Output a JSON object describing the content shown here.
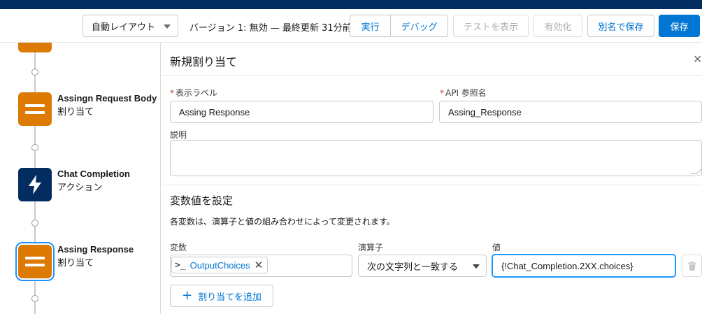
{
  "toolbar": {
    "layout_select": "自動レイアウト",
    "version_text": "バージョン 1: 無効 — 最終更新 31分前",
    "run_label": "実行",
    "debug_label": "デバッグ",
    "show_test_label": "テストを表示",
    "activate_label": "有効化",
    "save_as_label": "別名で保存",
    "save_label": "保存"
  },
  "canvas": {
    "nodes": [
      {
        "title": "Assingn Request Body",
        "subtitle": "割り当て",
        "type": "assignment"
      },
      {
        "title": "Chat Completion",
        "subtitle": "アクション",
        "type": "action"
      },
      {
        "title": "Assing Response",
        "subtitle": "割り当て",
        "type": "assignment",
        "selected": true
      }
    ]
  },
  "panel": {
    "title": "新規割り当て",
    "label_field": {
      "label": "表示ラベル",
      "value": "Assing Response",
      "required": true
    },
    "api_field": {
      "label": "API 参照名",
      "value": "Assing_Response",
      "required": true
    },
    "description_field": {
      "label": "説明",
      "value": ""
    },
    "section_title": "変数値を設定",
    "section_desc": "各変数は、演算子と値の組み合わせによって変更されます。",
    "columns": {
      "variable": "変数",
      "operator": "演算子",
      "value": "値"
    },
    "row": {
      "variable": "OutputChoices",
      "operator": "次の文字列と一致する",
      "value": "{!Chat_Completion.2XX.choices}"
    },
    "add_label": "割り当てを追加"
  },
  "colors": {
    "brand_blue": "#0176d3",
    "assignment_orange": "#dd7a01",
    "action_navy": "#032d60",
    "focus_blue": "#1b96ff"
  }
}
